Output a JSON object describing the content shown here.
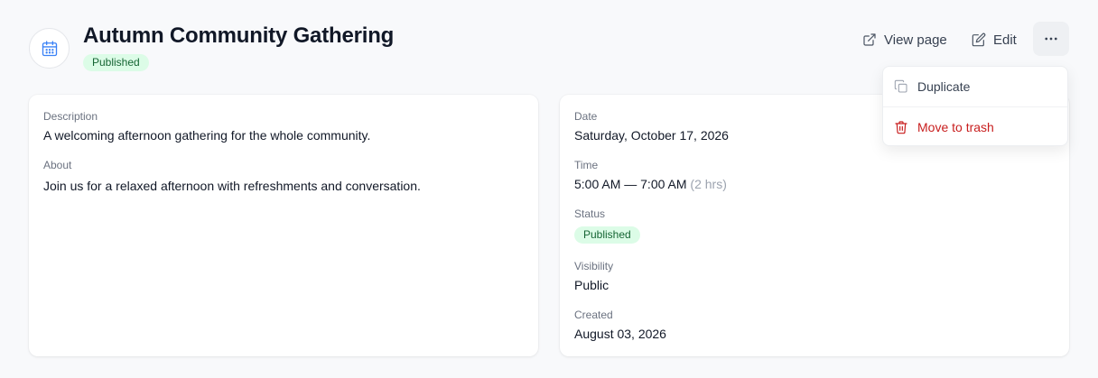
{
  "event": {
    "title": "Autumn Community Gathering",
    "status_badge": "Published"
  },
  "header_actions": {
    "view_page": "View page",
    "edit": "Edit"
  },
  "menu": {
    "duplicate": "Duplicate",
    "move_to_trash": "Move to trash"
  },
  "details": {
    "description_label": "Description",
    "description": "A welcoming afternoon gathering for the whole community.",
    "about_label": "About",
    "about": "Join us for a relaxed afternoon with refreshments and conversation."
  },
  "info": {
    "date_label": "Date",
    "date": "Saturday, October 17, 2026",
    "time_label": "Time",
    "time": "5:00 AM — 7:00 AM",
    "duration": "(2 hrs)",
    "status_label": "Status",
    "status": "Published",
    "visibility_label": "Visibility",
    "visibility": "Public",
    "created_label": "Created",
    "created": "August 03, 2026"
  },
  "icons": {
    "event": "calendar-icon",
    "view_page": "external-link-icon",
    "edit": "edit-icon",
    "more": "more-horizontal-icon",
    "duplicate": "copy-icon",
    "trash": "trash-icon"
  },
  "colors": {
    "accent": "#3b82f6",
    "badge_bg": "#dcfce7",
    "badge_text": "#166534",
    "danger": "#c81e1e"
  }
}
